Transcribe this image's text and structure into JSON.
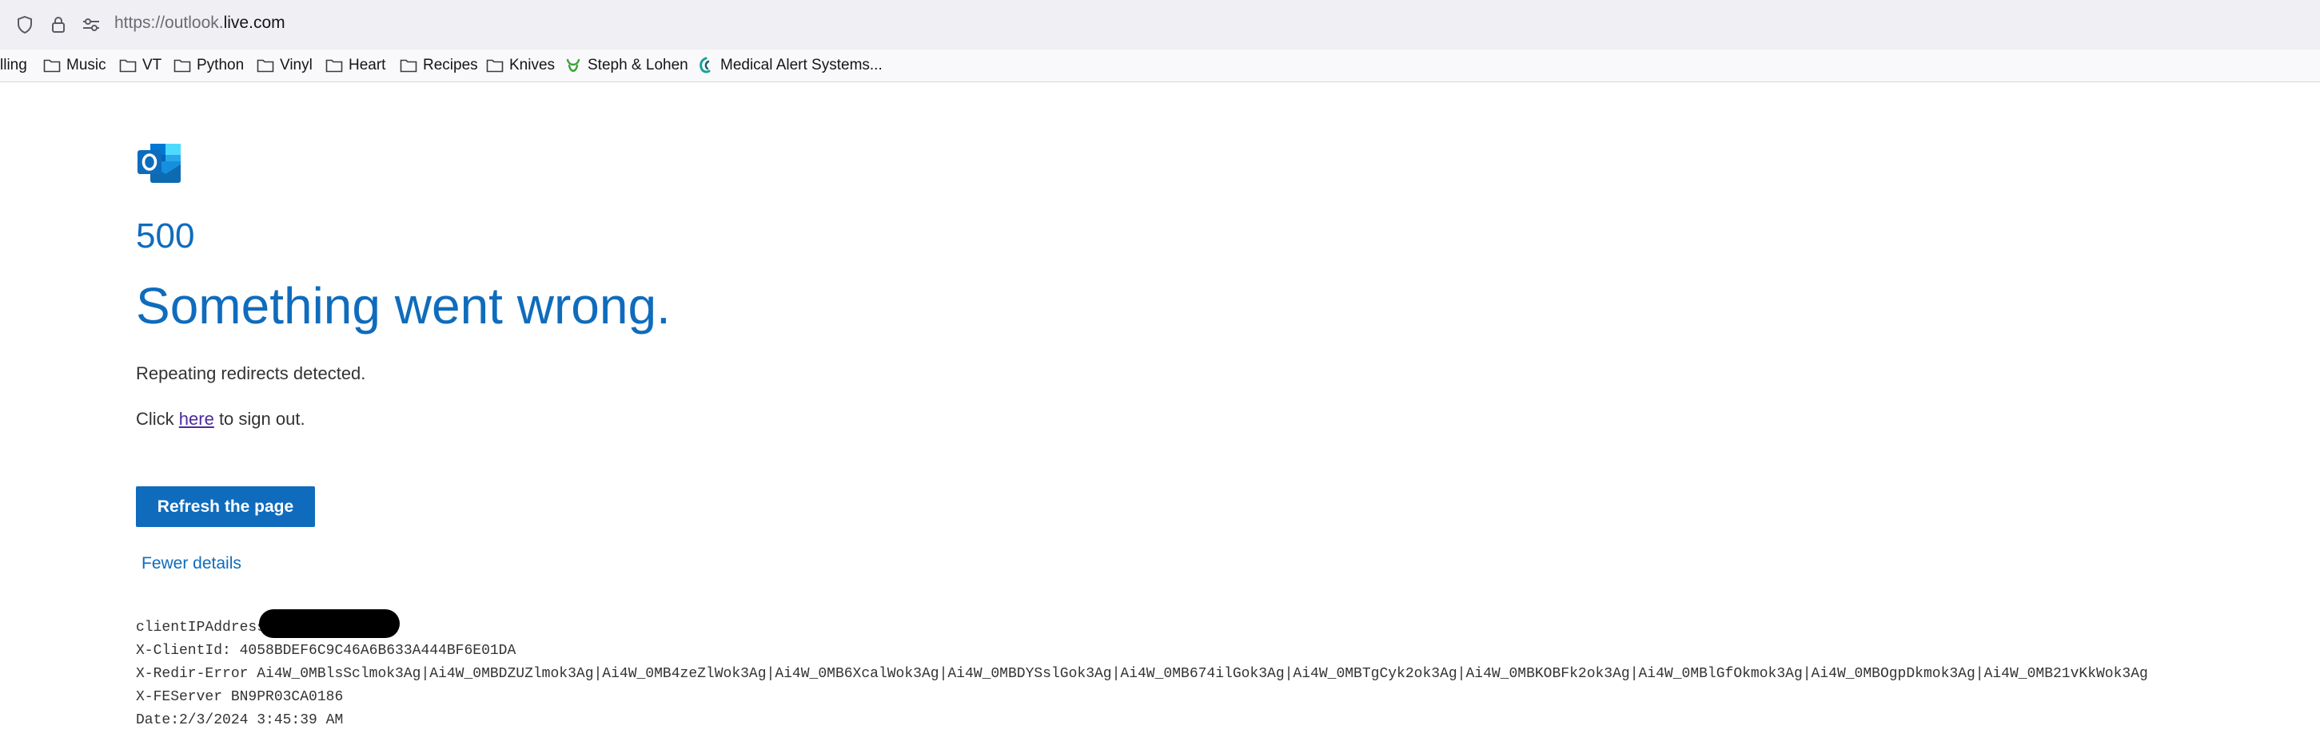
{
  "browser": {
    "url_prefix": "https://outlook.",
    "url_domain": "live.com",
    "icons": [
      "shield-icon",
      "lock-icon",
      "site-settings-icon"
    ]
  },
  "bookmarks": [
    {
      "label": "lling",
      "icon": "none"
    },
    {
      "label": "Music",
      "icon": "folder-icon"
    },
    {
      "label": "VT",
      "icon": "folder-icon"
    },
    {
      "label": "Python",
      "icon": "folder-icon"
    },
    {
      "label": "Vinyl",
      "icon": "folder-icon"
    },
    {
      "label": "Heart",
      "icon": "folder-icon"
    },
    {
      "label": "Recipes",
      "icon": "folder-icon"
    },
    {
      "label": "Knives",
      "icon": "folder-icon"
    },
    {
      "label": "Steph & Lohen",
      "icon": "smile-icon"
    },
    {
      "label": "Medical Alert Systems...",
      "icon": "medical-alert-icon"
    }
  ],
  "error": {
    "code": "500",
    "headline": "Something went wrong.",
    "message": "Repeating redirects detected.",
    "click_prefix": "Click ",
    "click_link": "here",
    "click_suffix": " to sign out.",
    "refresh_label": "Refresh the page",
    "fewer_details_label": "Fewer details"
  },
  "diagnostics": {
    "client_ip_label": "clientIPAddress",
    "client_id": "X-ClientId: 4058BDEF6C9C46A6B633A444BF6E01DA",
    "redir_error": "X-Redir-Error Ai4W_0MBlsSclmok3Ag|Ai4W_0MBDZUZlmok3Ag|Ai4W_0MB4zeZlWok3Ag|Ai4W_0MB6XcalWok3Ag|Ai4W_0MBDYSslGok3Ag|Ai4W_0MB674ilGok3Ag|Ai4W_0MBTgCyk2ok3Ag|Ai4W_0MBKOBFk2ok3Ag|Ai4W_0MBlGfOkmok3Ag|Ai4W_0MBOgpDkmok3Ag|Ai4W_0MB21vKkWok3Ag",
    "fe_server": "X-FEServer BN9PR03CA0186",
    "date": "Date:2/3/2024 3:45:39 AM"
  },
  "colors": {
    "accent": "#0f6cbd",
    "link_visited": "#4b2aa0"
  }
}
